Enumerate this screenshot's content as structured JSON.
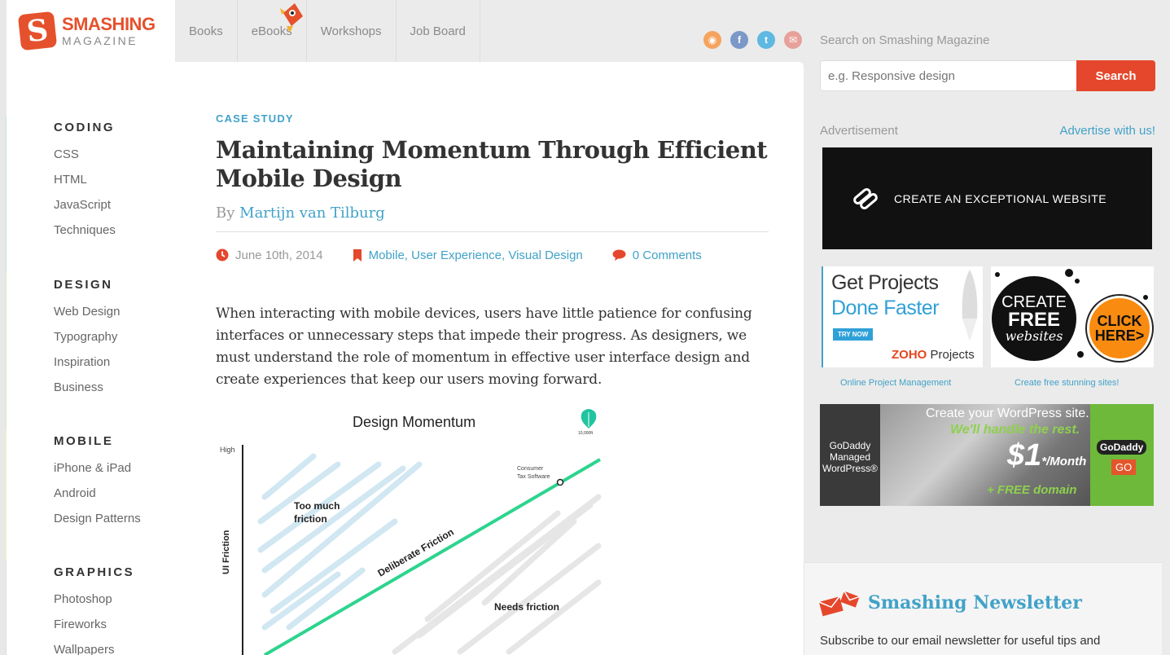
{
  "header": {
    "logo_line1": "SMASHING",
    "logo_line2": "MAGAZINE",
    "logo_letter": "S",
    "nav": [
      "Books",
      "eBooks",
      "Workshops",
      "Job Board"
    ]
  },
  "socials": [
    {
      "name": "rss-icon",
      "glyph": "◉",
      "color": "#f5a45f"
    },
    {
      "name": "facebook-icon",
      "glyph": "f",
      "color": "#7b98c7"
    },
    {
      "name": "twitter-icon",
      "glyph": "t",
      "color": "#5fb8e2"
    },
    {
      "name": "email-icon",
      "glyph": "✉",
      "color": "#e7a19a"
    }
  ],
  "search": {
    "label": "Search on Smashing Magazine",
    "placeholder": "e.g. Responsive design",
    "button": "Search"
  },
  "sidebar": {
    "categories": [
      {
        "title": "CODING",
        "links": [
          "CSS",
          "HTML",
          "JavaScript",
          "Techniques"
        ]
      },
      {
        "title": "DESIGN",
        "links": [
          "Web Design",
          "Typography",
          "Inspiration",
          "Business"
        ]
      },
      {
        "title": "MOBILE",
        "links": [
          "iPhone & iPad",
          "Android",
          "Design Patterns"
        ]
      },
      {
        "title": "GRAPHICS",
        "links": [
          "Photoshop",
          "Fireworks",
          "Wallpapers"
        ]
      }
    ]
  },
  "article": {
    "kicker": "CASE STUDY",
    "title": "Maintaining Momentum Through Efficient Mobile Design",
    "by": "By",
    "author": "Martijn van Tilburg",
    "date": "June 10th, 2014",
    "tags": "Mobile, User Experience, Visual Design",
    "comments": "0 Comments",
    "intro": "When interacting with mobile devices, users have little patience for confusing interfaces or unnecessary steps that impede their progress. As designers, we must understand the role of momentum in effective user interface design and create experiences that keep our users moving forward."
  },
  "figure": {
    "title": "Design Momentum",
    "logo_text": "10,000ft",
    "y_axis": "UI Friction",
    "y_high": "High",
    "label_too_much": "Too much",
    "label_friction": "friction",
    "label_deliberate": "Deliberate Friction",
    "label_needs": "Needs friction",
    "label_consumer": "Consumer",
    "label_tax": "Tax Software"
  },
  "ads": {
    "label": "Advertisement",
    "advertise_link": "Advertise with us!",
    "squarespace": "CREATE AN EXCEPTIONAL WEBSITE",
    "zoho_line1": "Get Projects",
    "zoho_line2": "Done Faster",
    "zoho_cta": "TRY NOW",
    "zoho_brand": "ZOHO",
    "zoho_product": "Projects",
    "zoho_caption": "Online Project Management",
    "create_1": "CREATE",
    "create_2": "FREE",
    "create_3": "websites",
    "click_1": "CLICK",
    "click_2": "HERE>",
    "create_caption": "Create free stunning sites!",
    "gd_left_1": "GoDaddy",
    "gd_left_2": "Managed",
    "gd_left_3": "WordPress®",
    "gd_t1": "Create your WordPress site.",
    "gd_t2": "We'll handle the rest.",
    "gd_price": "$1",
    "gd_star": "*",
    "gd_month": "/Month",
    "gd_t4": "+ FREE domain",
    "gd_logo": "GoDaddy",
    "gd_go": "GO"
  },
  "newsletter": {
    "title": "Smashing Newsletter",
    "text": "Subscribe to our email newsletter for useful tips and"
  },
  "colors": {
    "brand": "#e5512d",
    "link": "#41a2c8",
    "search_button": "#e5472c"
  }
}
